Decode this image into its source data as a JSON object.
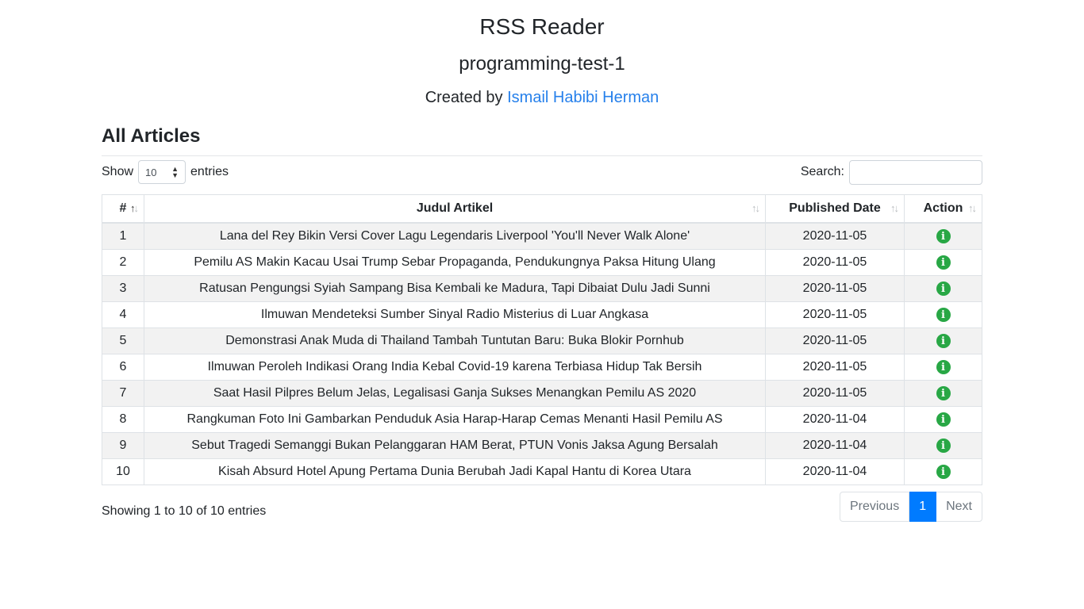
{
  "header": {
    "title": "RSS Reader",
    "subtitle": "programming-test-1",
    "credit_prefix": "Created by",
    "author": "Ismail Habibi Herman"
  },
  "section": {
    "title": "All Articles"
  },
  "controls": {
    "show_label": "Show",
    "entries_value": "10",
    "entries_label": "entries",
    "search_label": "Search:",
    "search_value": ""
  },
  "table": {
    "columns": [
      "#",
      "Judul Artikel",
      "Published Date",
      "Action"
    ],
    "rows": [
      {
        "no": "1",
        "title": "Lana del Rey Bikin Versi Cover Lagu Legendaris Liverpool 'You'll Never Walk Alone'",
        "date": "2020-11-05"
      },
      {
        "no": "2",
        "title": "Pemilu AS Makin Kacau Usai Trump Sebar Propaganda, Pendukungnya Paksa Hitung Ulang",
        "date": "2020-11-05"
      },
      {
        "no": "3",
        "title": "Ratusan Pengungsi Syiah Sampang Bisa Kembali ke Madura, Tapi Dibaiat Dulu Jadi Sunni",
        "date": "2020-11-05"
      },
      {
        "no": "4",
        "title": "Ilmuwan Mendeteksi Sumber Sinyal Radio Misterius di Luar Angkasa",
        "date": "2020-11-05"
      },
      {
        "no": "5",
        "title": "Demonstrasi Anak Muda di Thailand Tambah Tuntutan Baru: Buka Blokir Pornhub",
        "date": "2020-11-05"
      },
      {
        "no": "6",
        "title": "Ilmuwan Peroleh Indikasi Orang India Kebal Covid-19 karena Terbiasa Hidup Tak Bersih",
        "date": "2020-11-05"
      },
      {
        "no": "7",
        "title": "Saat Hasil Pilpres Belum Jelas, Legalisasi Ganja Sukses Menangkan Pemilu AS 2020",
        "date": "2020-11-05"
      },
      {
        "no": "8",
        "title": "Rangkuman Foto Ini Gambarkan Penduduk Asia Harap-Harap Cemas Menanti Hasil Pemilu AS",
        "date": "2020-11-04"
      },
      {
        "no": "9",
        "title": "Sebut Tragedi Semanggi Bukan Pelanggaran HAM Berat, PTUN Vonis Jaksa Agung Bersalah",
        "date": "2020-11-04"
      },
      {
        "no": "10",
        "title": "Kisah Absurd Hotel Apung Pertama Dunia Berubah Jadi Kapal Hantu di Korea Utara",
        "date": "2020-11-04"
      }
    ],
    "action_icon": "info-icon"
  },
  "footer": {
    "info": "Showing 1 to 10 of 10 entries",
    "previous": "Previous",
    "current_page": "1",
    "next": "Next"
  },
  "colors": {
    "link": "#2680eb",
    "active_page": "#007bff",
    "action_icon": "#28a745"
  }
}
